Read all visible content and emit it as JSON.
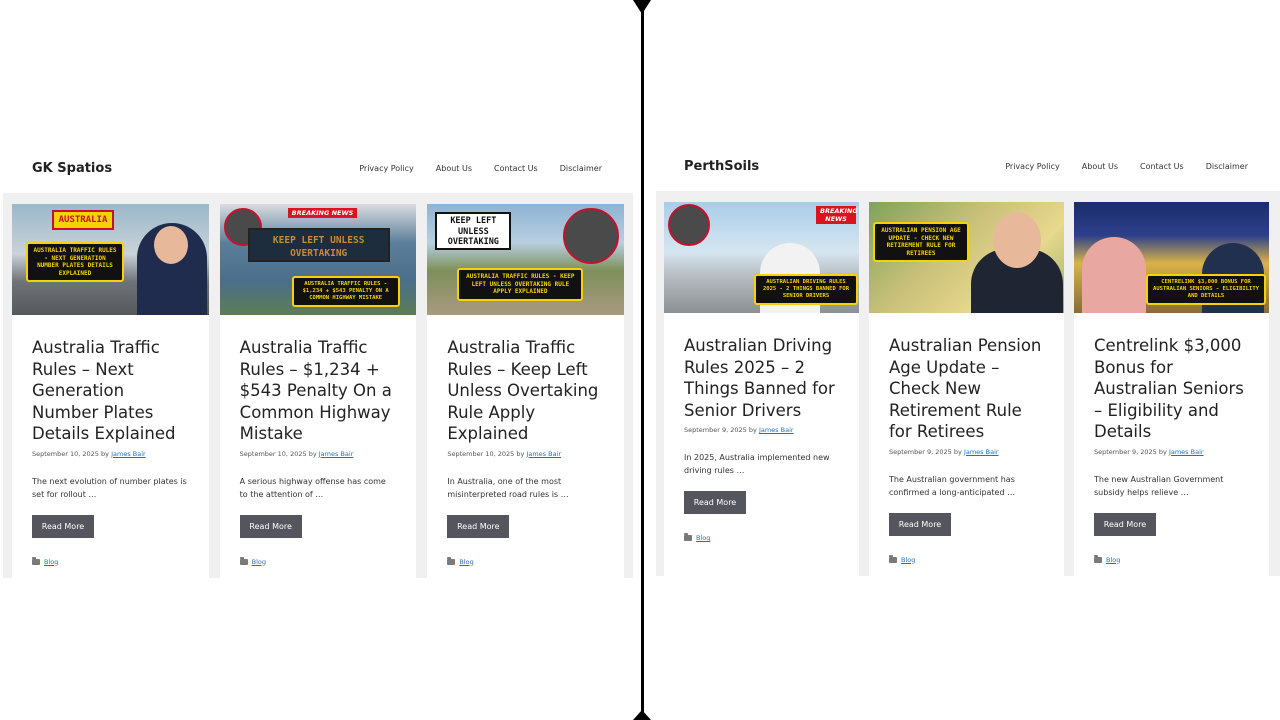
{
  "left": {
    "site_title": "GK Spatios",
    "nav": [
      "Privacy Policy",
      "About Us",
      "Contact Us",
      "Disclaimer"
    ],
    "posts": [
      {
        "title": "Australia Traffic Rules – Next Generation Number Plates Details Explained",
        "date": "September 10, 2025",
        "by": "by",
        "author": "James Bair",
        "excerpt": "The next evolution of number plates is set for rollout …",
        "read_more": "Read More",
        "category": "Blog",
        "thumb_sign": "AUSTRALIA",
        "thumb_caption": "AUSTRALIA TRAFFIC RULES - NEXT GENERATION NUMBER PLATES DETAILS EXPLAINED"
      },
      {
        "title": "Australia Traffic Rules – $1,234 + $543 Penalty On a Common Highway Mistake",
        "date": "September 10, 2025",
        "by": "by",
        "author": "James Bair",
        "excerpt": "A serious highway offense has come to the attention of …",
        "read_more": "Read More",
        "category": "Blog",
        "thumb_badge": "BREAKING NEWS",
        "thumb_sign": "KEEP LEFT UNLESS OVERTAKING",
        "thumb_caption": "AUSTRALIA TRAFFIC RULES - $1,234 + $543 PENALTY ON A COMMON HIGHWAY MISTAKE"
      },
      {
        "title": "Australia Traffic Rules – Keep Left Unless Overtaking Rule Apply Explained",
        "date": "September 10, 2025",
        "by": "by",
        "author": "James Bair",
        "excerpt": "In Australia, one of the most misinterpreted road rules is …",
        "read_more": "Read More",
        "category": "Blog",
        "thumb_sign": "KEEP LEFT UNLESS OVERTAKING",
        "thumb_caption": "AUSTRALIA TRAFFIC RULES - KEEP LEFT UNLESS OVERTAKING RULE APPLY EXPLAINED"
      }
    ]
  },
  "right": {
    "site_title": "PerthSoils",
    "nav": [
      "Privacy Policy",
      "About Us",
      "Contact Us",
      "Disclaimer"
    ],
    "posts": [
      {
        "title": "Australian Driving Rules 2025 – 2 Things Banned for Senior Drivers",
        "date": "September 9, 2025",
        "by": "by",
        "author": "James Bair",
        "excerpt": "In 2025, Australia implemented new driving rules …",
        "read_more": "Read More",
        "category": "Blog",
        "thumb_badge": "BREAKING NEWS",
        "thumb_caption": "AUSTRALIAN DRIVING RULES 2025 - 2 THINGS BANNED FOR SENIOR DRIVERS"
      },
      {
        "title": "Australian Pension Age Update – Check New Retirement Rule for Retirees",
        "date": "September 9, 2025",
        "by": "by",
        "author": "James Bair",
        "excerpt": "The Australian government has confirmed a long-anticipated …",
        "read_more": "Read More",
        "category": "Blog",
        "thumb_caption": "AUSTRALIAN PENSION AGE UPDATE - CHECK NEW RETIREMENT RULE FOR RETIREES"
      },
      {
        "title": "Centrelink $3,000 Bonus for Australian Seniors – Eligibility and Details",
        "date": "September 9, 2025",
        "by": "by",
        "author": "James Bair",
        "excerpt": "The new Australian Government subsidy helps relieve …",
        "read_more": "Read More",
        "category": "Blog",
        "thumb_caption": "CENTRELINK $3,000 BONUS FOR AUSTRALIAN SENIORS - ELIGIBILITY AND DETAILS"
      }
    ]
  },
  "colors": {
    "content_bg": "#f0f0f0",
    "button_bg": "#55555e",
    "link": "#1e73be",
    "divider": "#000000"
  }
}
